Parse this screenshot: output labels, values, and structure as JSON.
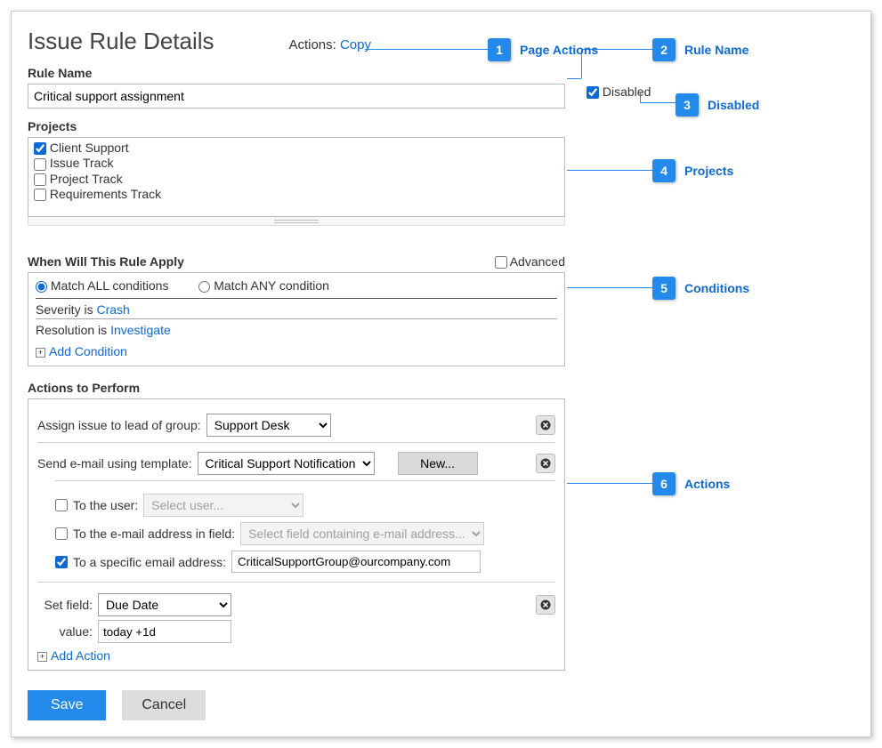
{
  "page": {
    "title": "Issue Rule Details",
    "actions_label": "Actions:",
    "copy_label": "Copy"
  },
  "ruleName": {
    "label": "Rule Name",
    "value": "Critical support assignment"
  },
  "disabled": {
    "label": "Disabled",
    "checked": true
  },
  "projects": {
    "label": "Projects",
    "items": [
      {
        "name": "Client Support",
        "checked": true
      },
      {
        "name": "Issue Track",
        "checked": false
      },
      {
        "name": "Project Track",
        "checked": false
      },
      {
        "name": "Requirements Track",
        "checked": false
      }
    ]
  },
  "whenApply": {
    "label": "When Will This Rule Apply",
    "advanced_label": "Advanced",
    "advanced_checked": false,
    "match_all": "Match ALL conditions",
    "match_any": "Match ANY condition",
    "match_mode": "all",
    "conditions": [
      {
        "field": "Severity",
        "verb": "is",
        "value": "Crash"
      },
      {
        "field": "Resolution",
        "verb": "is",
        "value": "Investigate"
      }
    ],
    "add_label": "Add Condition"
  },
  "actionsPerform": {
    "label": "Actions to Perform",
    "assign_label": "Assign issue to lead of group:",
    "assign_value": "Support Desk",
    "email_label": "Send e-mail using template:",
    "email_template": "Critical Support Notification",
    "new_label": "New...",
    "to_user_label": "To the user:",
    "to_user_checked": false,
    "to_user_placeholder": "Select user...",
    "to_field_label": "To the e-mail address in field:",
    "to_field_checked": false,
    "to_field_placeholder": "Select field containing e-mail address...",
    "to_addr_label": "To a specific email address:",
    "to_addr_checked": true,
    "to_addr_value": "CriticalSupportGroup@ourcompany.com",
    "set_field_label": "Set field:",
    "set_field_value": "Due Date",
    "value_label": "value:",
    "value_value": "today +1d",
    "add_action_label": "Add Action"
  },
  "buttons": {
    "save": "Save",
    "cancel": "Cancel"
  },
  "callouts": [
    {
      "num": "1",
      "text": "Page Actions"
    },
    {
      "num": "2",
      "text": "Rule Name"
    },
    {
      "num": "3",
      "text": "Disabled"
    },
    {
      "num": "4",
      "text": "Projects"
    },
    {
      "num": "5",
      "text": "Conditions"
    },
    {
      "num": "6",
      "text": "Actions"
    }
  ]
}
